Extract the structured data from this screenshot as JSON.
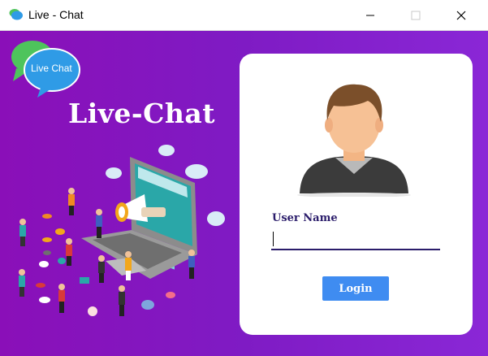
{
  "window": {
    "title": "Live - Chat",
    "controls": [
      "minimize",
      "maximize",
      "close"
    ]
  },
  "logo": {
    "text": "Live Chat",
    "colors": {
      "front_bubble": "#2f9be6",
      "back_bubble": "#4ec45c"
    }
  },
  "brand": {
    "title": "Live-Chat"
  },
  "login": {
    "username_label": "User Name",
    "username_value": "",
    "button_label": "Login"
  },
  "colors": {
    "background_start": "#8a0fb8",
    "background_end": "#8a27d6",
    "card": "#ffffff",
    "label": "#2b1d6b",
    "button": "#3f8cf1"
  },
  "icons": [
    "app-icon",
    "minimize-icon",
    "maximize-icon",
    "close-icon",
    "user-avatar-icon"
  ]
}
